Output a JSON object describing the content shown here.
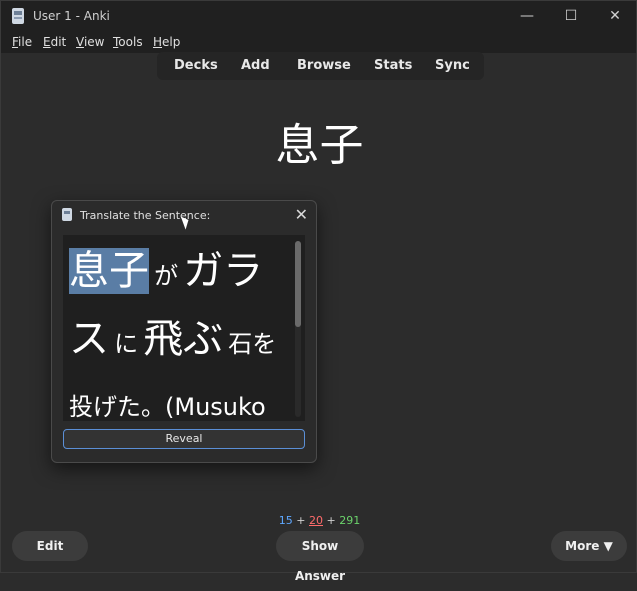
{
  "window": {
    "title": "User 1 - Anki"
  },
  "menu": [
    {
      "accel": "F",
      "rest": "ile"
    },
    {
      "accel": "E",
      "rest": "dit"
    },
    {
      "accel": "V",
      "rest": "iew"
    },
    {
      "accel": "T",
      "rest": "ools"
    },
    {
      "accel": "H",
      "rest": "elp"
    }
  ],
  "toolbar": {
    "decks": "Decks",
    "add": "Add",
    "browse": "Browse",
    "stats": "Stats",
    "sync": "Sync"
  },
  "card": {
    "word": "息子"
  },
  "dialog": {
    "title": "Translate the Sentence:",
    "close": "✕",
    "sentence": {
      "w1": "息子",
      "p1": "が",
      "w2": "ガラ",
      "w3": "ス",
      "p2": "に",
      "w4": "飛ぶ",
      "w5": "石を",
      "w6": "投げた。(Musuko"
    },
    "reveal": "Reveal"
  },
  "counts": {
    "new": "15",
    "learn": "20",
    "review": "291",
    "plus": "+"
  },
  "buttons": {
    "edit": "Edit",
    "show_answer": "Show Answer",
    "more": "More ▼"
  },
  "colors": {
    "highlight": "#5a7da5",
    "new": "#5fa8ff",
    "learn": "#ff6b6b",
    "review": "#6bd36b"
  }
}
